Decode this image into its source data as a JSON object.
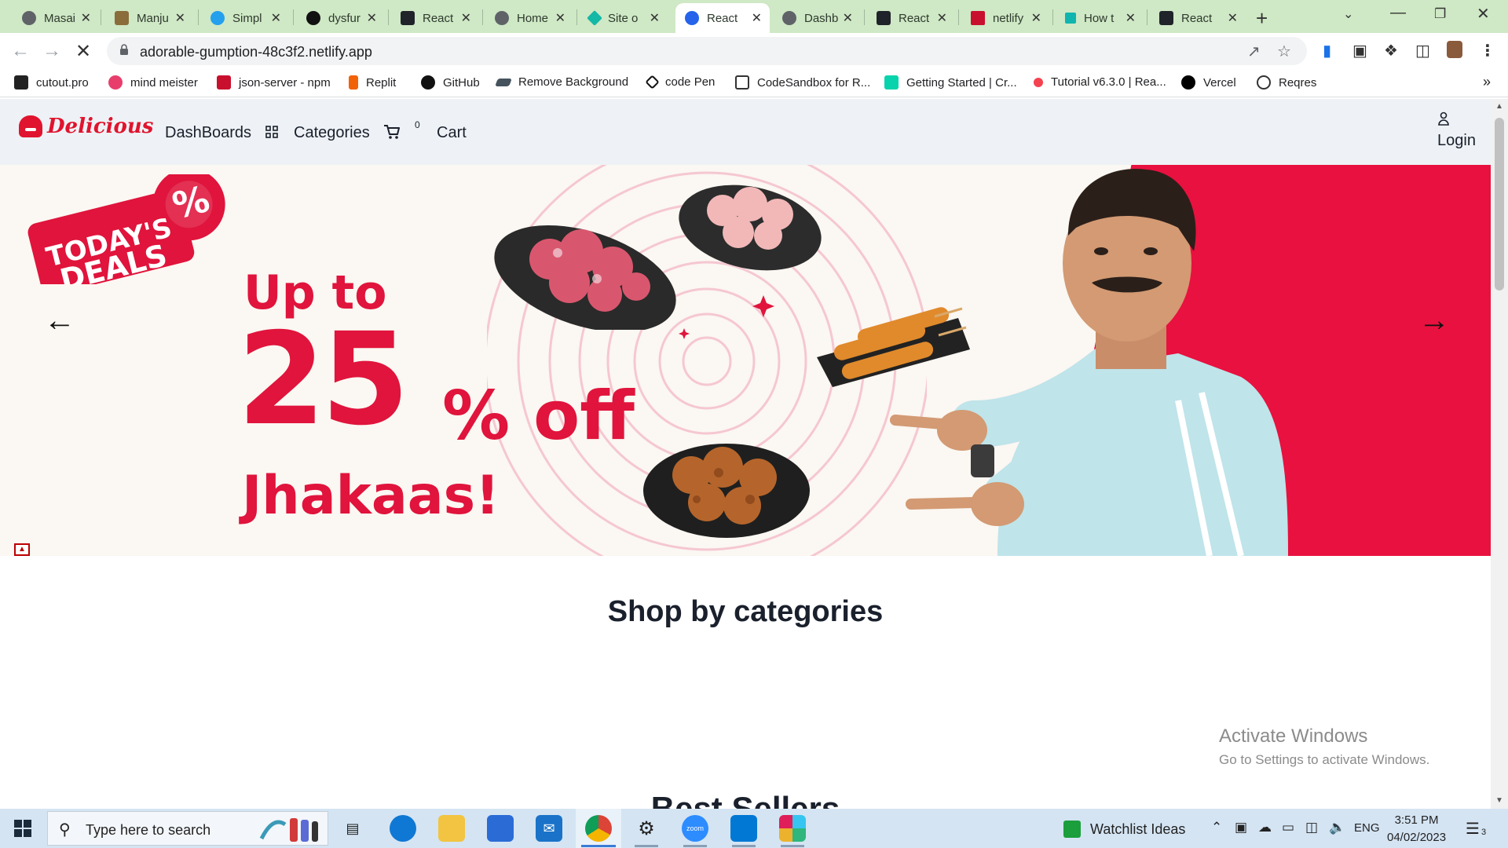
{
  "browser": {
    "tabs": [
      {
        "title": "Masai",
        "favicon_color": "#5f6368",
        "active": false
      },
      {
        "title": "Manju",
        "favicon_color": "#8a6d3b",
        "active": false
      },
      {
        "title": "Simpl",
        "favicon_color": "#24a0ed",
        "active": false
      },
      {
        "title": "dysfur",
        "favicon_color": "#111111",
        "active": false
      },
      {
        "title": "React",
        "favicon_color": "#20232a",
        "active": false
      },
      {
        "title": "Home",
        "favicon_color": "#5f6368",
        "active": false
      },
      {
        "title": "Site o",
        "favicon_color": "#14b8a6",
        "active": false
      },
      {
        "title": "React",
        "favicon_color": "#2563eb",
        "active": true
      },
      {
        "title": "Dashb",
        "favicon_color": "#5f6368",
        "active": false
      },
      {
        "title": "React",
        "favicon_color": "#20232a",
        "active": false
      },
      {
        "title": "netlify",
        "favicon_color": "#c8102e",
        "active": false
      },
      {
        "title": "How t",
        "favicon_color": "#0fb5ae",
        "active": false
      },
      {
        "title": "React",
        "favicon_color": "#20232a",
        "active": false
      }
    ],
    "tab_close_glyph": "✕",
    "new_tab_glyph": "+",
    "url": "adorable-gumption-48c3f2.netlify.app",
    "bookmarks": [
      {
        "label": "cutout.pro",
        "color": "#222222"
      },
      {
        "label": "mind meister",
        "color": "#e83e6c"
      },
      {
        "label": "json-server - npm",
        "color": "#c8102e"
      },
      {
        "label": "Replit",
        "color": "#f26207"
      },
      {
        "label": "GitHub",
        "color": "#111111"
      },
      {
        "label": "Remove Background",
        "color": "#45535e"
      },
      {
        "label": "code Pen",
        "color": "#111111"
      },
      {
        "label": "CodeSandbox for R...",
        "color": "#333333"
      },
      {
        "label": "Getting Started | Cr...",
        "color": "#09d3ac"
      },
      {
        "label": "Tutorial v6.3.0 | Rea...",
        "color": "#f44250"
      },
      {
        "label": "Vercel",
        "color": "#000000"
      },
      {
        "label": "Reqres",
        "color": "#333333"
      }
    ],
    "bookmarks_more": "»"
  },
  "site": {
    "logo_text": "Delicious",
    "nav": {
      "dashboards": "DashBoards",
      "categories": "Categories",
      "cart_count": "0",
      "cart": "Cart",
      "login": "Login"
    },
    "hero": {
      "badge_line1": "TODAY'S",
      "badge_line2": "DEALS",
      "badge_symbol": "%",
      "line1": "Up to",
      "line2": "25",
      "line3": "% off",
      "line4": "Jhakaas!",
      "prev_arrow": "←",
      "next_arrow": "→",
      "accent_color": "#e8113f"
    },
    "section_shop": "Shop by categories",
    "section_best": "Best Sellers"
  },
  "os": {
    "watermark_title": "Activate Windows",
    "watermark_sub": "Go to Settings to activate Windows.",
    "search_placeholder": "Type here to search",
    "watchlist": "Watchlist Ideas",
    "lang": "ENG",
    "time": "3:51 PM",
    "date": "04/02/2023",
    "notif_count": "3"
  }
}
